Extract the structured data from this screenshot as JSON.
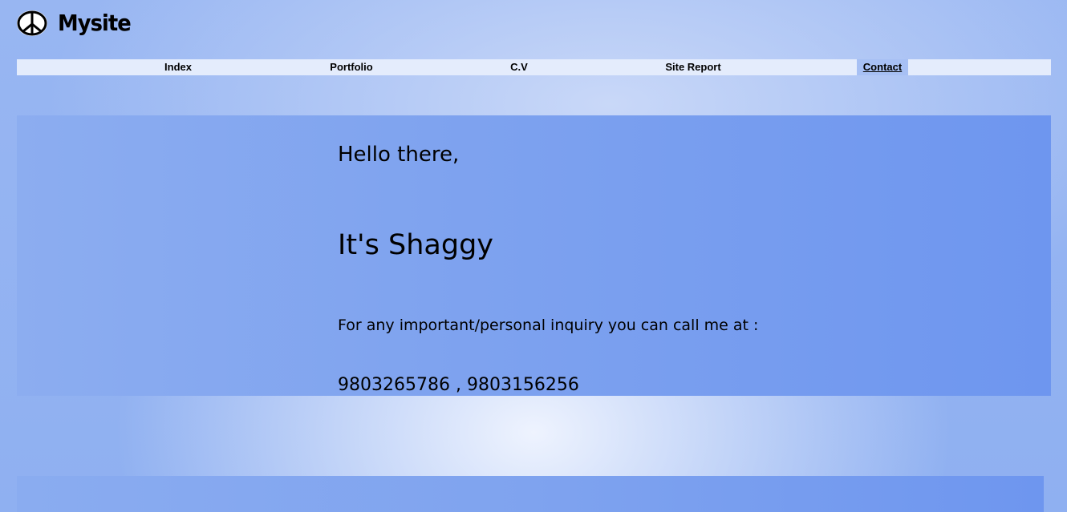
{
  "header": {
    "logo_icon": "peace-icon",
    "site_title": "Mysite"
  },
  "nav": {
    "items": [
      {
        "label": "Index"
      },
      {
        "label": "Portfolio"
      },
      {
        "label": "C.V"
      },
      {
        "label": "Site Report"
      },
      {
        "label": "Contact",
        "active": true
      }
    ]
  },
  "content": {
    "greeting": "Hello there,",
    "name_line": "It's Shaggy",
    "inquiry": "For any important/personal inquiry you can call me at :",
    "phones": "9803265786 , 9803156256"
  },
  "colors": {
    "background": "#8fb0f1",
    "nav_bar": "#e4ecfc",
    "nav_active": "#a7c0f4",
    "content_panel": "#7fa3ef",
    "text": "#000000"
  }
}
